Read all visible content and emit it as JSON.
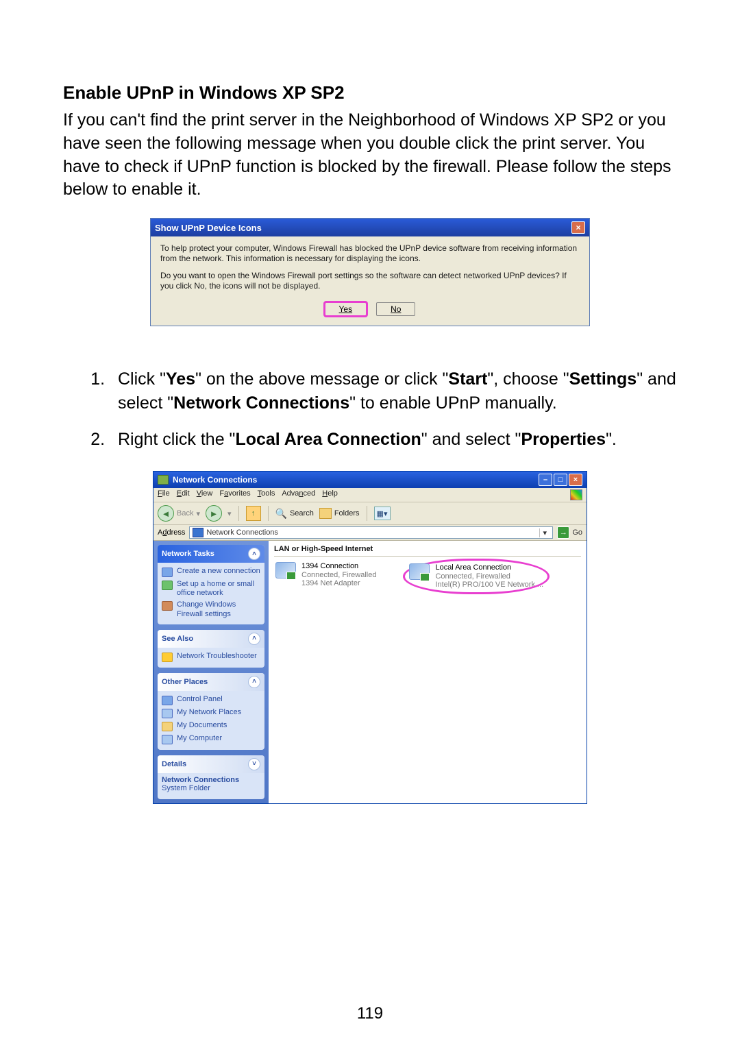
{
  "heading": "Enable UPnP in Windows XP SP2",
  "intro": "If you can't find the print server in the Neighborhood of Windows XP SP2 or you have seen the following message when you double click the print server. You have to check if UPnP function is blocked by the firewall. Please follow the steps below to enable it.",
  "dialog": {
    "title": "Show UPnP Device Icons",
    "line1": "To help protect your computer, Windows Firewall has blocked the UPnP device software from receiving information from the network. This information is necessary for displaying the icons.",
    "line2": "Do you want to open the Windows Firewall port settings so the software can detect networked UPnP devices? If you click No, the icons will not be displayed.",
    "yes": "Yes",
    "no": "No"
  },
  "steps": {
    "s1a": "Click \"",
    "s1b": "Yes",
    "s1c": "\" on the above message or click \"",
    "s1d": "Start",
    "s1e": "\", choose \"",
    "s1f": "Settings",
    "s1g": "\" and select \"",
    "s1h": "Network Connections",
    "s1i": "\" to enable UPnP manually.",
    "s2a": "Right click the \"",
    "s2b": "Local Area Connection",
    "s2c": "\" and select \"",
    "s2d": "Properties",
    "s2e": "\"."
  },
  "nc": {
    "title": "Network Connections",
    "menu": {
      "file": "File",
      "edit": "Edit",
      "view": "View",
      "fav": "Favorites",
      "tools": "Tools",
      "adv": "Advanced",
      "help": "Help"
    },
    "toolbar": {
      "back": "Back",
      "search": "Search",
      "folders": "Folders"
    },
    "addressLabel": "Address",
    "addressValue": "Network Connections",
    "go": "Go",
    "sidebar": {
      "tasksTitle": "Network Tasks",
      "task1": "Create a new connection",
      "task2": "Set up a home or small office network",
      "task3": "Change Windows Firewall settings",
      "seeAlsoTitle": "See Also",
      "see1": "Network Troubleshooter",
      "otherTitle": "Other Places",
      "o1": "Control Panel",
      "o2": "My Network Places",
      "o3": "My Documents",
      "o4": "My Computer",
      "detailsTitle": "Details",
      "detailsName": "Network Connections",
      "detailsType": "System Folder"
    },
    "content": {
      "groupHeader": "LAN or High-Speed Internet",
      "conn1": {
        "name": "1394 Connection",
        "line2": "Connected, Firewalled",
        "line3": "1394 Net Adapter"
      },
      "conn2": {
        "name": "Local Area Connection",
        "line2": "Connected, Firewalled",
        "line3": "Intel(R) PRO/100 VE Network ..."
      }
    }
  },
  "pageNumber": "119"
}
